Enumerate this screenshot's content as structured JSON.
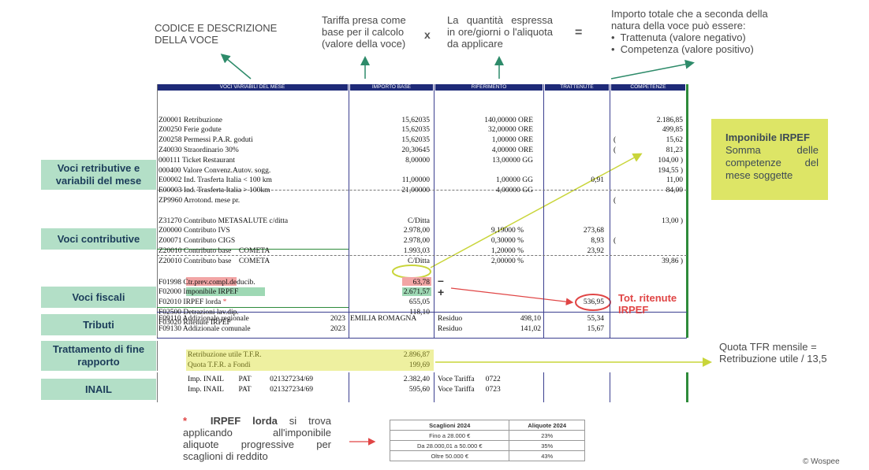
{
  "annotations": {
    "codice": "CODICE E DESCRIZIONE DELLA VOCE",
    "tariffa": "Tariffa presa come base per il calcolo (valore della voce)",
    "times": "x",
    "quantita": "La quantità espressa in ore/giorni o l'aliquota da applicare",
    "equals": "=",
    "importo_title": "Importo totale che a seconda della natura della voce può essere:",
    "importo_items": [
      "Trattenuta (valore negativo)",
      "Competenza (valore positivo)"
    ],
    "imponibile_title": "Imponibile IRPEF",
    "imponibile_text": "Somma delle competenze del mese soggette",
    "tot_ritenute": "Tot. ritenute IRPEF",
    "tfr_note": "Quota TFR mensile = Retribuzione utile / 13,5",
    "irpef_star": "*",
    "irpef_bold": "IRPEF lorda",
    "irpef_text": "si trova applicando all'imponibile aliquote progressive per scaglioni di reddito",
    "minus": "–",
    "plus": "+",
    "copyright": "© Wospee"
  },
  "table_headers": [
    "VOCI VARIABILI DEL MESE",
    "IMPORTO BASE",
    "RIFERIMENTO",
    "TRATTENUTE",
    "COMPETENZE"
  ],
  "labels": [
    "Voci retributive e variabili del mese",
    "Voci contributive",
    "Voci fiscali",
    "Tributi",
    "Trattamento di fine rapporto",
    "INAIL"
  ],
  "retributive": {
    "codes": [
      "Z00001 Retribuzione",
      "Z00250 Ferie godute",
      "Z00258 Permessi P.A.R. goduti",
      "Z40030 Straordinario 30%",
      "000111 Ticket Restaurant",
      "000400 Valore Convenz.Autov. sogg.",
      "E00002 Ind. Trasferta Italia < 100 km",
      "E00003 Ind. Trasferta Italia > 100km",
      "ZP9960 Arrotond. mese pr."
    ],
    "base": [
      "15,62035",
      "15,62035",
      "15,62035",
      "20,30645",
      "8,00000",
      "",
      "11,00000",
      "21,00000",
      ""
    ],
    "rif": [
      "140,00000 ORE",
      "32,00000 ORE",
      "1,00000 ORE",
      "4,00000 ORE",
      "13,00000 GG",
      "",
      "1,00000 GG",
      "4,00000 GG",
      ""
    ],
    "tratt": [
      "",
      "",
      "",
      "",
      "",
      "",
      "",
      "",
      "0,91"
    ],
    "comp_paren": [
      "",
      "",
      "",
      "",
      "(",
      "(",
      "",
      "",
      ""
    ],
    "comp": [
      "2.186,85",
      "499,85",
      "15,62",
      "81,23",
      "104,00 )",
      "194,55 )",
      "11,00",
      "84,00",
      ""
    ]
  },
  "contributive": {
    "codes": [
      "Z31270 Contributo METASALUTE c/ditta",
      "Z00000 Contributo IVS",
      "Z00071 Contributo CIGS",
      "Z20010 Contributo base    COMETA",
      "Z20010 Contributo base    COMETA"
    ],
    "base": [
      "C/Ditta",
      "2.978,00",
      "2.978,00",
      "1.993,03",
      "C/Ditta"
    ],
    "rif": [
      "",
      "9,19000 %",
      "0,30000 %",
      "1,20000 %",
      "2,00000 %"
    ],
    "tratt": [
      "",
      "273,68",
      "8,93",
      "23,92",
      ""
    ],
    "comp_paren": [
      "(",
      "",
      "",
      "",
      "("
    ],
    "comp": [
      "13,00 )",
      "",
      "",
      "",
      "39,86 )"
    ]
  },
  "fiscali": {
    "codes": [
      "F01998 Ctr.prev.compl.deducib.",
      "F02000 Imponibile IRPEF",
      "F02010 IRPEF lorda",
      "F02500 Detrazioni lav.dip.",
      "F03020 Ritenute IRPEF"
    ],
    "base": [
      "63,78",
      "2.671,57",
      "655,05",
      "118,10",
      ""
    ],
    "tratt": [
      "",
      "",
      "",
      "",
      "536,95"
    ]
  },
  "tributi": {
    "codes": [
      "F09110 Addizionale regionale",
      "F09130 Addizionale comunale"
    ],
    "years": [
      "2023",
      "2023"
    ],
    "region": "EMILIA ROMAGNA",
    "residuo_label": [
      "Residuo",
      "Residuo"
    ],
    "residuo": [
      "498,10",
      "141,02"
    ],
    "tratt": [
      "55,34",
      "15,67"
    ]
  },
  "tfr": {
    "codes": [
      "Retribuzione utile T.F.R.",
      "Quota T.F.R. a Fondi"
    ],
    "base": [
      "2.896,87",
      "199,69"
    ]
  },
  "inail": {
    "codes": [
      "Imp. INAIL        PAT          021327234/69",
      "Imp. INAIL        PAT          021327234/69"
    ],
    "base": [
      "2.382,40",
      "595,60"
    ],
    "rif": [
      "Voce Tariffa      0722",
      "Voce Tariffa      0723"
    ]
  },
  "scaglioni": {
    "headers": [
      "Scaglioni 2024",
      "Aliquote 2024"
    ],
    "rows": [
      [
        "Fino a 28.000 €",
        "23%"
      ],
      [
        "Da 28.000,01 a 50.000 €",
        "35%"
      ],
      [
        "Oltre 50.000 €",
        "43%"
      ]
    ]
  },
  "colors": {
    "green_label": "#b3dfc7",
    "yellow_box": "#dde566",
    "header_blue": "#1e2a78",
    "highlight_red": "#f2a5a5",
    "highlight_green": "#9ed8b4",
    "highlight_yellow": "#eef0a0",
    "arrow_red": "#e04545"
  }
}
